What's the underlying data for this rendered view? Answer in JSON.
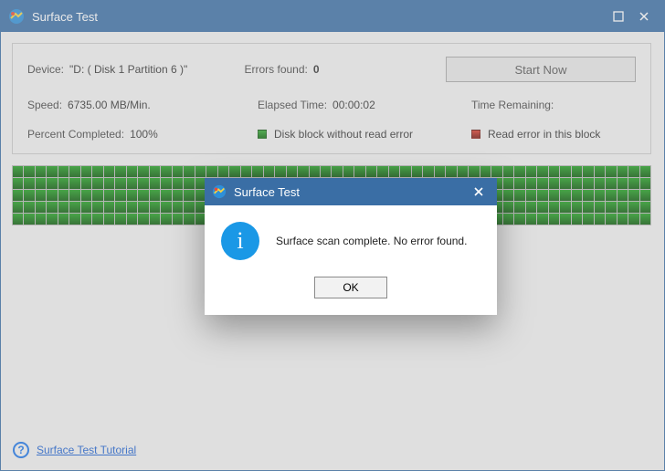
{
  "window": {
    "title": "Surface Test"
  },
  "info": {
    "device_label": "Device:",
    "device_value": "\"D: ( Disk 1 Partition 6 )\"",
    "speed_label": "Speed:",
    "speed_value": "6735.00 MB/Min.",
    "percent_label": "Percent Completed:",
    "percent_value": "100%",
    "errors_label": "Errors found:",
    "errors_value": "0",
    "elapsed_label": "Elapsed Time:",
    "elapsed_value": "00:00:02",
    "legend_ok": "Disk block without read error",
    "remaining_label": "Time Remaining:",
    "remaining_value": "",
    "legend_err": "Read error in this block",
    "start_btn": "Start Now"
  },
  "grid": {
    "columns": 56,
    "rows": 5
  },
  "footer": {
    "tutorial": "Surface Test Tutorial"
  },
  "dialog": {
    "title": "Surface Test",
    "message": "Surface scan complete. No error found.",
    "ok": "OK"
  }
}
